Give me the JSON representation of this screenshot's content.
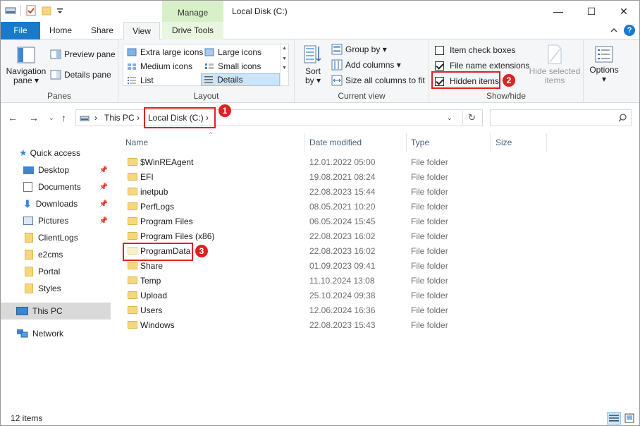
{
  "window": {
    "title": "Local Disk (C:)",
    "manage_tab": "Manage",
    "controls": {
      "minimize": "—",
      "maximize": "☐",
      "close": "✕"
    }
  },
  "ribbon_tabs": {
    "file": "File",
    "home": "Home",
    "share": "Share",
    "view": "View",
    "drive_tools": "Drive Tools"
  },
  "panes_group": {
    "label": "Panes",
    "navigation_pane": "Navigation",
    "navigation_pane_2": "pane ▾",
    "preview_pane": "Preview pane",
    "details_pane": "Details pane"
  },
  "layout_group": {
    "label": "Layout",
    "extra_large": "Extra large icons",
    "large": "Large icons",
    "medium": "Medium icons",
    "small": "Small icons",
    "list": "List",
    "details": "Details"
  },
  "current_view_group": {
    "label": "Current view",
    "sort_by": "Sort",
    "sort_by_2": "by ▾",
    "group_by": "Group by ▾",
    "add_columns": "Add columns ▾",
    "size_all_columns": "Size all columns to fit"
  },
  "show_hide_group": {
    "label": "Show/hide",
    "item_check_boxes": "Item check boxes",
    "file_name_extensions": "File name extensions",
    "hidden_items": "Hidden items",
    "hide_selected": "Hide selected",
    "hide_selected_2": "items",
    "options": "Options",
    "options_arrow": "▾"
  },
  "checkboxes": {
    "item_check_boxes": false,
    "file_name_extensions": true,
    "hidden_items": true
  },
  "annotations": {
    "one": "1",
    "two": "2",
    "three": "3"
  },
  "address": {
    "crumbs": [
      "This PC",
      "Local Disk (C:)"
    ],
    "separator": "›",
    "refresh": "↻"
  },
  "nav_pane": {
    "quick_access": "Quick access",
    "items": [
      "Desktop",
      "Documents",
      "Downloads",
      "Pictures",
      "ClientLogs",
      "e2cms",
      "Portal",
      "Styles"
    ],
    "this_pc": "This PC",
    "network": "Network"
  },
  "columns": {
    "name": "Name",
    "date_modified": "Date modified",
    "type": "Type",
    "size": "Size"
  },
  "files": [
    {
      "name": "$WinREAgent",
      "date": "12.01.2022 05:00",
      "type": "File folder"
    },
    {
      "name": "EFI",
      "date": "19.08.2021 08:24",
      "type": "File folder"
    },
    {
      "name": "inetpub",
      "date": "22.08.2023 15:44",
      "type": "File folder"
    },
    {
      "name": "PerfLogs",
      "date": "08.05.2021 10:20",
      "type": "File folder"
    },
    {
      "name": "Program Files",
      "date": "06.05.2024 15:45",
      "type": "File folder"
    },
    {
      "name": "Program Files (x86)",
      "date": "22.08.2023 16:02",
      "type": "File folder"
    },
    {
      "name": "ProgramData",
      "date": "22.08.2023 16:02",
      "type": "File folder"
    },
    {
      "name": "Share",
      "date": "01.09.2023 09:41",
      "type": "File folder"
    },
    {
      "name": "Temp",
      "date": "11.10.2024 13:08",
      "type": "File folder"
    },
    {
      "name": "Upload",
      "date": "25.10.2024 09:38",
      "type": "File folder"
    },
    {
      "name": "Users",
      "date": "12.06.2024 16:36",
      "type": "File folder"
    },
    {
      "name": "Windows",
      "date": "22.08.2023 15:43",
      "type": "File folder"
    }
  ],
  "status": {
    "item_count": "12 items"
  },
  "colors": {
    "accent": "#1979ca",
    "annotation": "#dd2222",
    "folder": "#f6d77c",
    "manage": "#d8f0c8"
  }
}
